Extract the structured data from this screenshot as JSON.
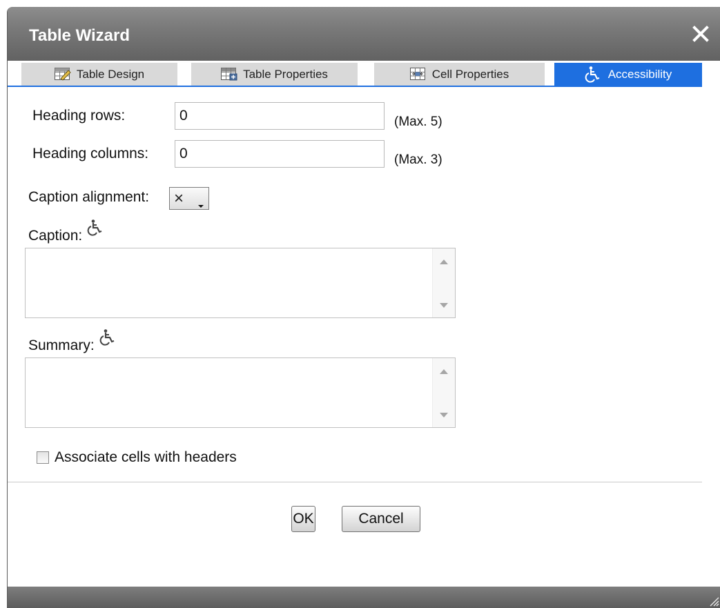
{
  "window": {
    "title": "Table Wizard"
  },
  "tabs": [
    {
      "label": "Table Design",
      "icon": "table-design-icon",
      "active": false
    },
    {
      "label": "Table Properties",
      "icon": "table-properties-icon",
      "active": false
    },
    {
      "label": "Cell Properties",
      "icon": "cell-properties-icon",
      "active": false
    },
    {
      "label": "Accessibility",
      "icon": "accessibility-icon",
      "active": true
    }
  ],
  "form": {
    "heading_rows": {
      "label": "Heading rows:",
      "value": "0",
      "hint": "(Max. 5)"
    },
    "heading_columns": {
      "label": "Heading columns:",
      "value": "0",
      "hint": "(Max. 3)"
    },
    "caption_alignment": {
      "label": "Caption alignment:",
      "selected": "×"
    },
    "caption": {
      "label": "Caption:",
      "value": ""
    },
    "summary": {
      "label": "Summary:",
      "value": ""
    },
    "associate_cells": {
      "label": "Associate cells with headers",
      "checked": false
    }
  },
  "buttons": {
    "ok": "OK",
    "cancel": "Cancel"
  },
  "colors": {
    "active_tab": "#1e6fe0",
    "inactive_tab": "#d9d9d9",
    "titlebar": "#6e6e6e"
  }
}
